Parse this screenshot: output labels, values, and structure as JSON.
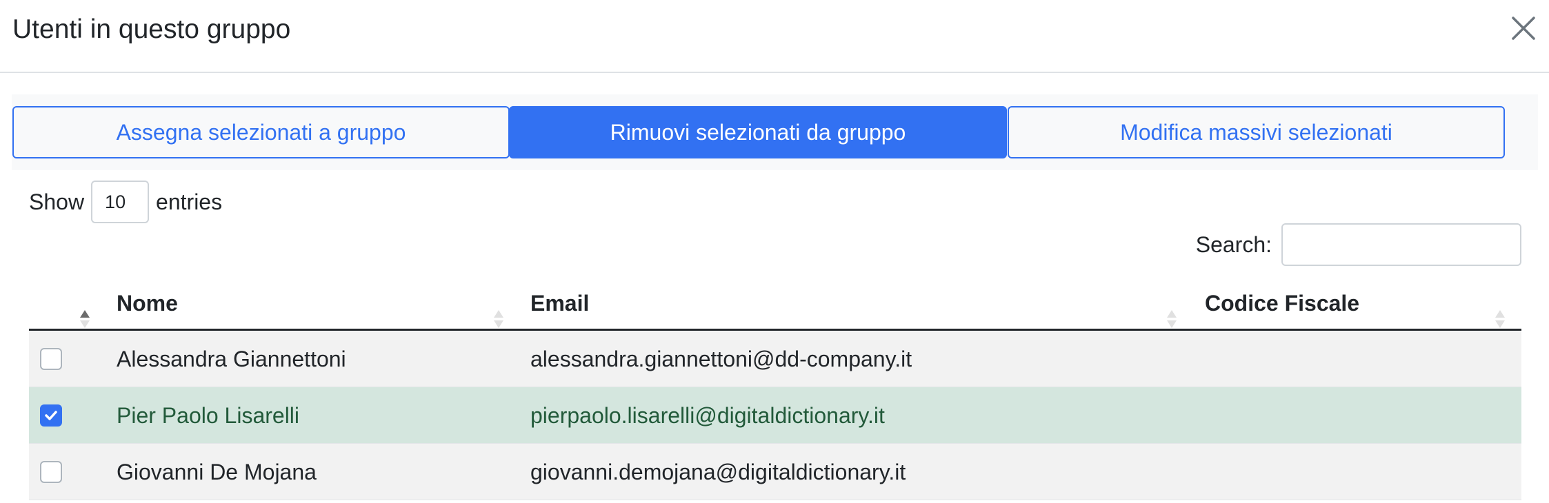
{
  "modal": {
    "title": "Utenti in questo gruppo"
  },
  "actions": {
    "assign_label": "Assegna selezionati a gruppo",
    "remove_label": "Rimuovi selezionati da gruppo",
    "bulk_edit_label": "Modifica massivi selezionati"
  },
  "length_menu": {
    "prefix": "Show",
    "value": "10",
    "suffix": "entries"
  },
  "search": {
    "label": "Search:",
    "value": ""
  },
  "table": {
    "headers": [
      "Nome",
      "Email",
      "Codice Fiscale"
    ],
    "rows": [
      {
        "checked": false,
        "nome": "Alessandra Giannettoni",
        "email": "alessandra.giannettoni@dd-company.it",
        "codice_fiscale": ""
      },
      {
        "checked": true,
        "nome": "Pier Paolo Lisarelli",
        "email": "pierpaolo.lisarelli@digitaldictionary.it",
        "codice_fiscale": ""
      },
      {
        "checked": false,
        "nome": "Giovanni De Mojana",
        "email": "giovanni.demojana@digitaldictionary.it",
        "codice_fiscale": ""
      }
    ]
  },
  "colors": {
    "accent": "#3271f2",
    "selected_row_bg": "#d4e6de",
    "selected_row_text": "#225a3a",
    "striped_row_bg": "#f2f2f2"
  },
  "icons": {
    "close": "close-icon",
    "sort": "sort-arrows-icon",
    "check": "check-icon"
  }
}
